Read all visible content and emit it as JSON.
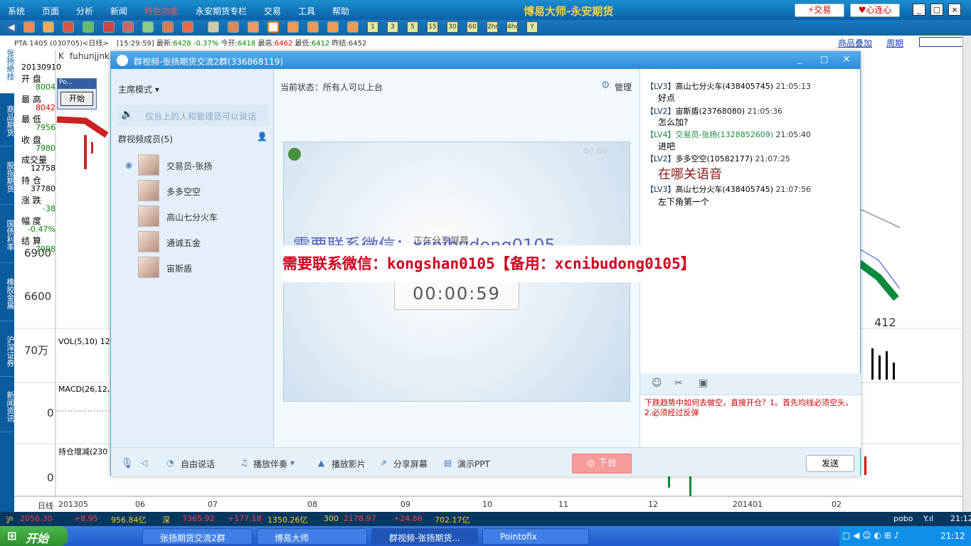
{
  "menu": {
    "items": [
      "系统",
      "页面",
      "分析",
      "新闻",
      "特色功能",
      "永安期货专栏",
      "交易",
      "工具",
      "帮助"
    ],
    "title": "博易大师-永安期货",
    "trade_btn": "交易",
    "xinlian_btn": "心连心"
  },
  "toolbar": {
    "periods": [
      "1",
      "3",
      "5",
      "15",
      "30",
      "60",
      "2hr",
      "4hr",
      "Y"
    ]
  },
  "left_tabs": [
    "张扬绝技",
    "商品期货",
    "股指期货",
    "国债利率",
    "橡胶金属",
    "沪深证券",
    "新闻资讯"
  ],
  "chart": {
    "info": "PTA 1405 (030705)<日线>",
    "clock": "[15:29:59]",
    "latest_lbl": "最新:",
    "latest": "6428",
    "chg": "-0.37%",
    "open_lbl": "今开:",
    "open": "6418",
    "high_lbl": "最高:",
    "high": "6462",
    "low_lbl": "最低:",
    "low": "6412",
    "prev_lbl": "昨结:",
    "prev": "6452",
    "overlay": "商品叠加",
    "period": "周期",
    "k_label": "K",
    "user": "fuhunjjnk",
    "date": "20130910",
    "y1": "6900",
    "y2": "6600",
    "vol_lbl": "70万",
    "vol_ind": "VOL(5,10) 12",
    "macd_ind": "MACD(26,12,",
    "macd_zero": "0",
    "oi_ind": "持仓增减(230",
    "oi_zero": "0",
    "last_price": "412",
    "xaxis": [
      "日线",
      "201305",
      "06",
      "07",
      "08",
      "09",
      "10",
      "11",
      "12",
      "201401",
      "02"
    ]
  },
  "stats": [
    {
      "label": "开 盘",
      "value": "8004",
      "color": "grn"
    },
    {
      "label": "最 高",
      "value": "8042",
      "color": "red"
    },
    {
      "label": "最 低",
      "value": "7956",
      "color": "grn"
    },
    {
      "label": "收 盘",
      "value": "7980",
      "color": "grn"
    },
    {
      "label": "成交量",
      "value": "12758",
      "color": ""
    },
    {
      "label": "持 仓",
      "value": "37780",
      "color": ""
    },
    {
      "label": "涨 跌",
      "value": "-38",
      "color": "grn"
    },
    {
      "label": "幅 度",
      "value": "-0.47%",
      "color": "grn"
    },
    {
      "label": "结 算",
      "value": "7998",
      "color": "grn"
    }
  ],
  "popup": {
    "title": "Po...",
    "button": "开始"
  },
  "video": {
    "title": "群视频-张扬期货交流2群(336868119)",
    "mode": "主席模式",
    "hint": "仅台上的人和管理员可以说话",
    "members_header": "群视频成员(5)",
    "members": [
      "交易员-张扬",
      "多多空空",
      "高山七分火车",
      "通诚五金",
      "宙斯盾"
    ],
    "status": "当前状态：所有人可以上台",
    "manage": "管理",
    "timer": "00:00:59",
    "share_text": "正在分享屏幕",
    "ghost_text": "需要联系微信：xcnibudong0105",
    "banner": "需要联系微信：kongshan0105【备用：xcnibudong0105】",
    "messages": [
      {
        "lv": "【LV3】",
        "name": "高山七分火车(438405745)",
        "time": "21:05:13",
        "text": "好点"
      },
      {
        "lv": "【LV2】",
        "name": "宙斯盾(23768080)",
        "time": "21:05:36",
        "text": "怎么加?"
      },
      {
        "lv": "【LV4】",
        "name": "交易员-张扬(1328852609)",
        "time": "21:05:40",
        "text": "进吧"
      },
      {
        "lv": "【LV2】",
        "name": "多多空空(10582177)",
        "time": "21:07:25",
        "text": "在哪关语音"
      },
      {
        "lv": "【LV3】",
        "name": "高山七分火车(438405745)",
        "time": "21:07:56",
        "text": "左下角第一个"
      }
    ],
    "input_text": "下跌趋势中如何去做空，直接开仓？1。首先均线必须空头，2.必须经过反弹",
    "bottom": [
      "自由说话",
      "播放伴奏",
      "播放影片",
      "分享屏幕",
      "演示PPT"
    ],
    "down": "下台",
    "send": "发送"
  },
  "ticker": {
    "sh_lbl": "沪",
    "sh": "2056.30",
    "sh_chg": "+8.95",
    "sh_amt": "956.84亿",
    "sz_lbl": "深",
    "sz": "7365.92",
    "sz_chg": "+177.18",
    "sz_amt": "1350.26亿",
    "hs_lbl": "300",
    "hs": "2178.97",
    "hs_chg": "+24.86",
    "hs_amt": "702.17亿",
    "brand": "pobo",
    "time": "21:12"
  },
  "taskbar": {
    "start": "开始",
    "tasks": [
      "张扬期货交流2群",
      "博易大师",
      "群视频-张扬期货...",
      "Pointofix"
    ],
    "time": "21:12"
  }
}
